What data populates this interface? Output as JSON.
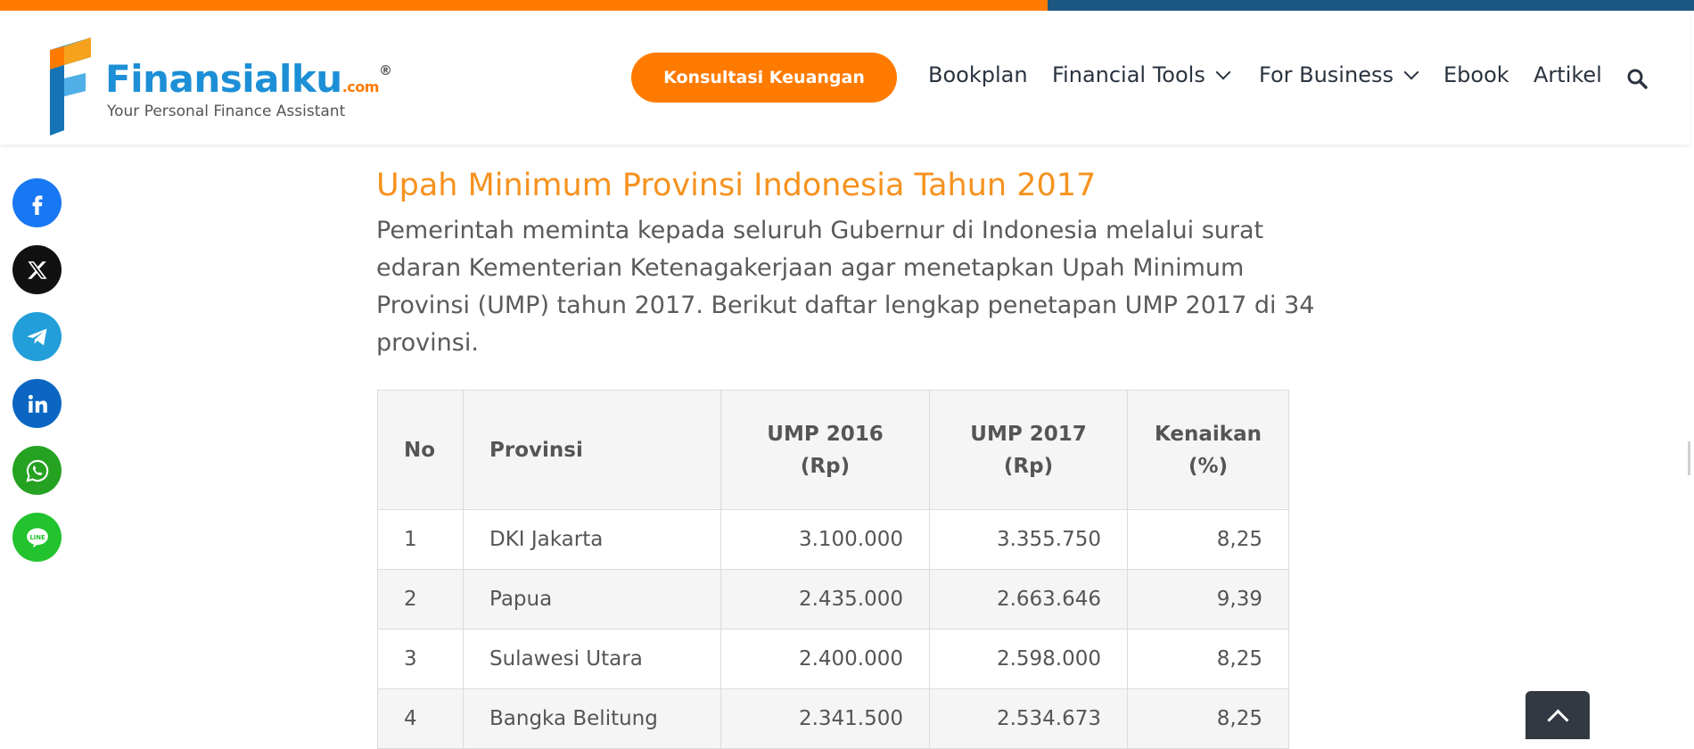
{
  "colors": {
    "orange": "#ff7b00",
    "navy": "#1b5780",
    "title_orange": "#f6921e",
    "logo_blue": "#1c8fd6"
  },
  "logo": {
    "brand": "Finansialku",
    "domain": ".com",
    "registered": "®",
    "tagline": "Your Personal Finance Assistant"
  },
  "header": {
    "cta_label": "Konsultasi Keuangan",
    "nav": [
      {
        "label": "Bookplan"
      },
      {
        "label": "Financial Tools"
      },
      {
        "label": "For Business"
      },
      {
        "label": "Ebook"
      },
      {
        "label": "Artikel"
      }
    ],
    "search_icon": "search-icon"
  },
  "share_icons": [
    "facebook-icon",
    "x-icon",
    "telegram-icon",
    "linkedin-icon",
    "whatsapp-icon",
    "line-icon"
  ],
  "article": {
    "heading": "Upah Minimum Provinsi Indonesia Tahun 2017",
    "intro": "Pemerintah meminta kepada seluruh Gubernur di Indonesia melalui surat edaran Kementerian Ketenagakerjaan agar menetapkan Upah Minimum Provinsi (UMP) tahun 2017. Berikut daftar lengkap penetapan UMP 2017 di 34 provinsi."
  },
  "table": {
    "headers": {
      "no": "No",
      "provinsi": "Provinsi",
      "ump2016_a": "UMP 2016",
      "ump2016_b": "(Rp)",
      "ump2017_a": "UMP 2017",
      "ump2017_b": "(Rp)",
      "kenaikan_a": "Kenaikan",
      "kenaikan_b": "(%)"
    },
    "rows": [
      {
        "no": "1",
        "provinsi": "DKI Jakarta",
        "ump2016": "3.100.000",
        "ump2017": "3.355.750",
        "kenaikan": "8,25"
      },
      {
        "no": "2",
        "provinsi": "Papua",
        "ump2016": "2.435.000",
        "ump2017": "2.663.646",
        "kenaikan": "9,39"
      },
      {
        "no": "3",
        "provinsi": "Sulawesi Utara",
        "ump2016": "2.400.000",
        "ump2017": "2.598.000",
        "kenaikan": "8,25"
      },
      {
        "no": "4",
        "provinsi": "Bangka Belitung",
        "ump2016": "2.341.500",
        "ump2017": "2.534.673",
        "kenaikan": "8,25"
      }
    ]
  },
  "back_to_top_icon": "chevron-up-icon"
}
